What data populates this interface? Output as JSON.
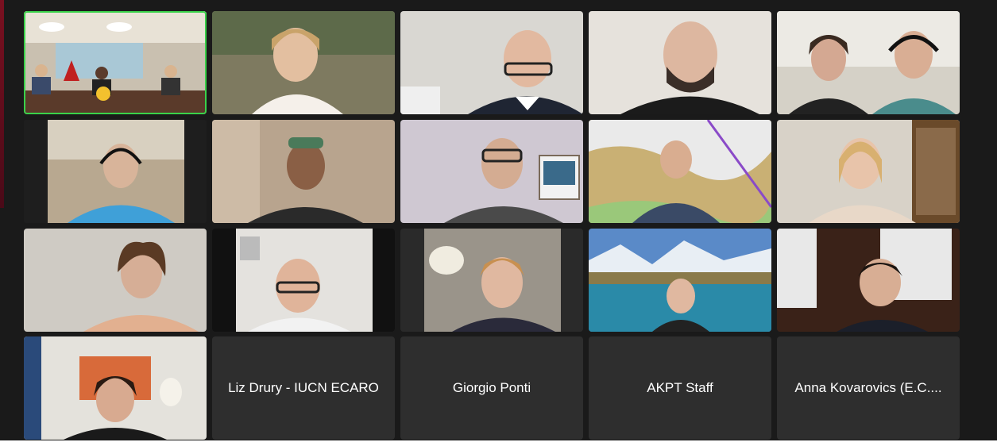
{
  "meeting": {
    "gallery": {
      "active_speaker_color": "#3ad24a",
      "tiles": [
        {
          "type": "video",
          "video": "conference-room-video"
        },
        {
          "type": "video",
          "video": "participant-video"
        },
        {
          "type": "video",
          "video": "participant-video"
        },
        {
          "type": "video",
          "video": "participant-video"
        },
        {
          "type": "video",
          "video": "participant-video"
        },
        {
          "type": "video",
          "video": "participant-video"
        },
        {
          "type": "video",
          "video": "participant-video"
        },
        {
          "type": "video",
          "video": "participant-video"
        },
        {
          "type": "video",
          "video": "participant-video"
        },
        {
          "type": "video",
          "video": "participant-video"
        },
        {
          "type": "video",
          "video": "participant-video"
        },
        {
          "type": "video",
          "video": "participant-video"
        },
        {
          "type": "video",
          "video": "participant-video"
        },
        {
          "type": "video",
          "video": "participant-video"
        },
        {
          "type": "video",
          "video": "participant-video"
        },
        {
          "type": "video",
          "video": "participant-video"
        },
        {
          "type": "name",
          "name": "Liz Drury - IUCN ECARO"
        },
        {
          "type": "name",
          "name": "Giorgio Ponti"
        },
        {
          "type": "name",
          "name": "AKPT Staff"
        },
        {
          "type": "name",
          "name": "Anna Kovarovics (E.C...."
        }
      ]
    }
  }
}
